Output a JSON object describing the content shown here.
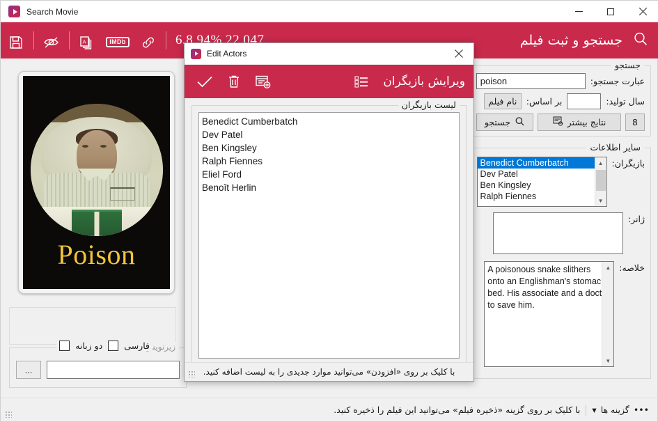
{
  "window": {
    "title": "Search Movie",
    "app_icon": "play-logo-icon",
    "minimize": "minimize-icon",
    "maximize": "maximize-icon",
    "close": "close-icon"
  },
  "appbar": {
    "title": "جستجو و ثبت فیلم",
    "search_icon": "search-icon",
    "accent_color": "#c9294b",
    "tools": [
      {
        "name": "save-icon"
      },
      {
        "name": "eye-slash-icon"
      },
      {
        "name": "copy-pages-icon"
      },
      {
        "name": "imdb-icon",
        "label": "IMDb"
      },
      {
        "name": "link-icon"
      }
    ],
    "stats": "6.8  94%  22,047"
  },
  "poster": {
    "title": "Poison",
    "title_color": "#f2c33c",
    "background_color": "#0b0a08"
  },
  "subtitle_group": {
    "legend": "زیرنویس",
    "checkboxes": [
      {
        "label": "فارسی",
        "checked": false
      },
      {
        "label": "دو زبانه",
        "checked": false
      }
    ],
    "browse_button": "...",
    "path_value": ""
  },
  "search_group": {
    "legend": "جستجو",
    "query_label": "عبارت جستجو:",
    "query_value": "poison",
    "year_label": "سال تولید:",
    "year_value": "",
    "basis_label": "بر اساس:",
    "basis_value": "نام فیلم",
    "count_button": "8",
    "more_results_button": "نتایج بیشتر",
    "more_results_icon": "more-results-icon",
    "search_button": "جستجو",
    "search_icon": "search-icon"
  },
  "other_info_group": {
    "legend": "سایر اطلاعات",
    "actors_label": "بازیگران:",
    "actors_items": [
      "Benedict Cumberbatch",
      "Dev Patel",
      "Ben Kingsley",
      "Ralph Fiennes"
    ],
    "actors_selected_index": 0,
    "genre_label": "ژانر:",
    "genre_value": "",
    "summary_label": "خلاصه:",
    "summary_lines": [
      "A poisonous snake slithers",
      "onto an Englishman's stomach in",
      "bed. His associate and a doctor race",
      "to save him."
    ]
  },
  "dialog": {
    "title": "Edit Actors",
    "app_icon": "play-logo-icon",
    "close": "close-icon",
    "toolbar": {
      "title": "ویرایش بازیگران",
      "list_icon": "bullet-list-icon",
      "confirm_icon": "check-icon",
      "delete_icon": "trash-icon",
      "add_icon": "add-list-item-icon"
    },
    "group_legend": "لیست بازیگران",
    "actors": [
      "Benedict Cumberbatch",
      "Dev Patel",
      "Ben Kingsley",
      "Ralph Fiennes",
      "Eliel Ford",
      "Benoît Herlin"
    ],
    "status_text": "با کلیک بر روی «افزودن» می‌توانید موارد جدیدی را به لیست اضافه کنید."
  },
  "statusbar": {
    "options_label": "گزینه ها",
    "options_dots": "•••",
    "options_caret": "▾",
    "hint": "با کلیک بر روی گزینه «ذخیره فیلم» می‌توانید این فیلم را ذخیره کنید."
  }
}
